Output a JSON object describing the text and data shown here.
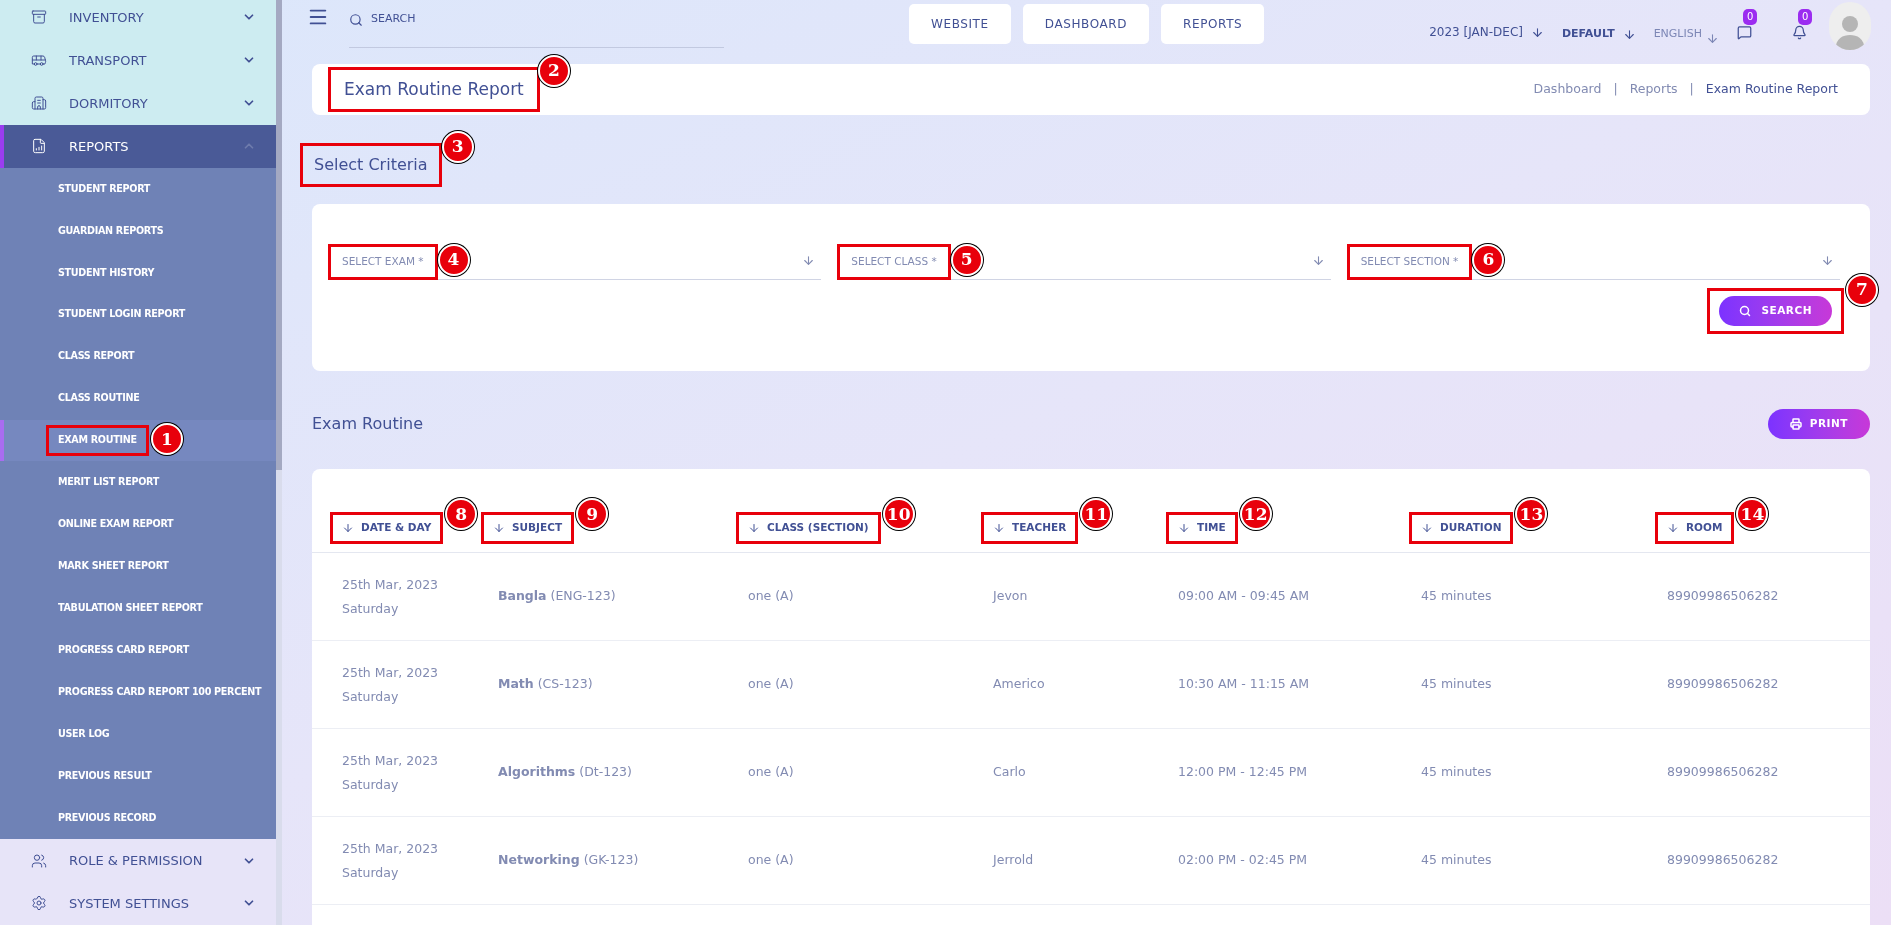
{
  "sidebar": {
    "items": [
      {
        "label": "INVENTORY",
        "expanded": false,
        "selected": false
      },
      {
        "label": "TRANSPORT",
        "expanded": false,
        "selected": false
      },
      {
        "label": "DORMITORY",
        "expanded": false,
        "selected": false
      },
      {
        "label": "REPORTS",
        "expanded": true,
        "selected": true,
        "children": [
          {
            "label": "STUDENT REPORT",
            "selected": false
          },
          {
            "label": "GUARDIAN REPORTS",
            "selected": false
          },
          {
            "label": "STUDENT HISTORY",
            "selected": false
          },
          {
            "label": "STUDENT LOGIN REPORT",
            "selected": false
          },
          {
            "label": "CLASS REPORT",
            "selected": false
          },
          {
            "label": "CLASS ROUTINE",
            "selected": false
          },
          {
            "label": "EXAM ROUTINE",
            "selected": true,
            "callout": "1"
          },
          {
            "label": "MERIT LIST REPORT",
            "selected": false
          },
          {
            "label": "ONLINE EXAM REPORT",
            "selected": false
          },
          {
            "label": "MARK SHEET REPORT",
            "selected": false
          },
          {
            "label": "TABULATION SHEET REPORT",
            "selected": false
          },
          {
            "label": "PROGRESS CARD REPORT",
            "selected": false
          },
          {
            "label": "PROGRESS CARD REPORT 100 PERCENT",
            "selected": false
          },
          {
            "label": "USER LOG",
            "selected": false
          },
          {
            "label": "PREVIOUS RESULT",
            "selected": false
          },
          {
            "label": "PREVIOUS RECORD",
            "selected": false
          }
        ]
      },
      {
        "label": "ROLE & PERMISSION",
        "expanded": false,
        "selected": false
      },
      {
        "label": "SYSTEM SETTINGS",
        "expanded": false,
        "selected": false
      }
    ]
  },
  "topbar": {
    "search": {
      "placeholder": "SEARCH"
    },
    "nav_buttons": [
      "WEBSITE",
      "DASHBOARD",
      "REPORTS"
    ],
    "session": "2023 [JAN-DEC]",
    "style": "DEFAULT",
    "language": "ENGLISH",
    "messages_count": "0",
    "notifications_count": "0"
  },
  "page_header": {
    "title": "Exam Routine Report",
    "callout": "2",
    "breadcrumb": [
      {
        "label": "Dashboard",
        "selected": false
      },
      {
        "label": "Reports",
        "selected": false,
        "separator": "|"
      },
      {
        "label": "Exam Routine Report",
        "selected": true,
        "separator": "|"
      }
    ]
  },
  "criteria": {
    "title": "Select Criteria",
    "callout": "3",
    "fields": [
      {
        "placeholder": "SELECT EXAM *",
        "callout": "4"
      },
      {
        "placeholder": "SELECT CLASS *",
        "callout": "5"
      },
      {
        "placeholder": "SELECT SECTION *",
        "callout": "6"
      }
    ],
    "search_button": {
      "label": "SEARCH",
      "callout": "7"
    }
  },
  "routine": {
    "title": "Exam Routine",
    "print_button": "PRINT",
    "columns": [
      {
        "label": "DATE & DAY",
        "callout": "8"
      },
      {
        "label": "SUBJECT",
        "callout": "9"
      },
      {
        "label": "CLASS (SECTION)",
        "callout": "10"
      },
      {
        "label": "TEACHER",
        "callout": "11"
      },
      {
        "label": "TIME",
        "callout": "12"
      },
      {
        "label": "DURATION",
        "callout": "13"
      },
      {
        "label": "ROOM",
        "callout": "14"
      }
    ],
    "rows": [
      {
        "date": "25th Mar, 2023",
        "day": "Saturday",
        "subject": "**Bangla** (ENG-123)",
        "class": "one (A)",
        "teacher": "Jevon",
        "time": "09:00 AM - 09:45 AM",
        "duration": "45 minutes",
        "room": "89909986506282"
      },
      {
        "date": "25th Mar, 2023",
        "day": "Saturday",
        "subject": "**Math** (CS-123)",
        "class": "one (A)",
        "teacher": "Americo",
        "time": "10:30 AM - 11:15 AM",
        "duration": "45 minutes",
        "room": "89909986506282"
      },
      {
        "date": "25th Mar, 2023",
        "day": "Saturday",
        "subject": "**Algorithms** (Dt-123)",
        "class": "one (A)",
        "teacher": "Carlo",
        "time": "12:00 PM - 12:45 PM",
        "duration": "45 minutes",
        "room": "89909986506282"
      },
      {
        "date": "25th Mar, 2023",
        "day": "Saturday",
        "subject": "**Networking** (GK-123)",
        "class": "one (A)",
        "teacher": "Jerrold",
        "time": "02:00 PM - 02:45 PM",
        "duration": "45 minutes",
        "room": "89909986506282"
      }
    ]
  }
}
